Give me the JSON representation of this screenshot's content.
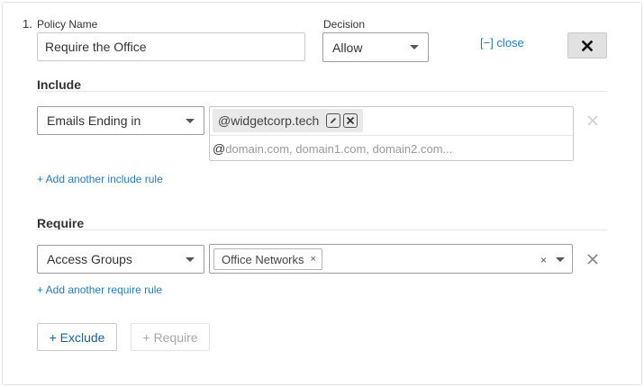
{
  "policy": {
    "number": "1.",
    "name_label": "Policy Name",
    "name_value": "Require the Office",
    "decision_label": "Decision",
    "decision_value": "Allow",
    "close_link": "[−] close"
  },
  "include": {
    "title": "Include",
    "rule_type": "Emails Ending in",
    "tags": [
      "@widgetcorp.tech"
    ],
    "input_prefix": "@",
    "input_placeholder": "domain.com, domain1.com, domain2.com...",
    "add_rule_link": "+ Add another include rule"
  },
  "require": {
    "title": "Require",
    "rule_type": "Access Groups",
    "tokens": [
      {
        "label": "Office Networks",
        "remove": "×"
      }
    ],
    "clear": "×",
    "add_rule_link": "+ Add another require rule"
  },
  "actions": {
    "exclude_label": "+ Exclude",
    "require_label": "+ Require"
  },
  "colors": {
    "link": "#2a7ab0",
    "disabled_text": "#a9a9a9",
    "close_button_bg": "#e1e1e1"
  },
  "icons": {
    "close": "close-icon",
    "edit": "pencil-icon",
    "remove": "x-box-icon",
    "remove_row": "x-icon",
    "dropdown": "caret-down-icon"
  }
}
